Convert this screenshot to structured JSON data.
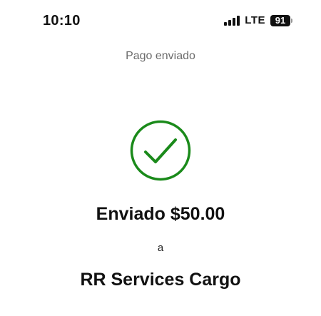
{
  "status_bar": {
    "time": "10:10",
    "network": "LTE",
    "battery": "91",
    "signal_bars": 4
  },
  "header": {
    "title": "Pago enviado"
  },
  "confirmation": {
    "icon": "checkmark-circle-icon",
    "accent_color": "#1a8a1a",
    "sent_text": "Enviado $50.00",
    "to_text": "a",
    "recipient": "RR Services Cargo"
  }
}
